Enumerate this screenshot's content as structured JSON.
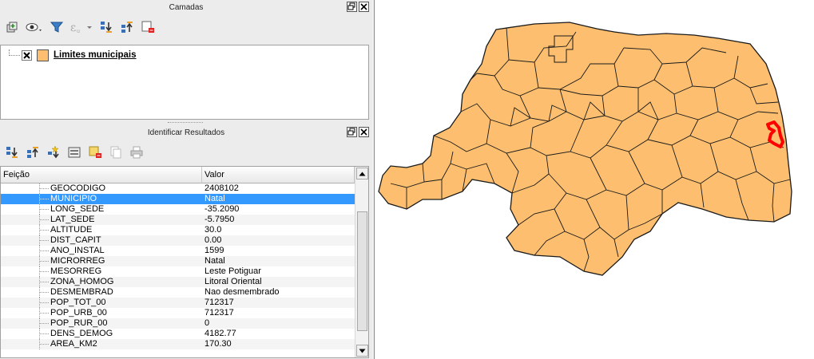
{
  "layers_dock": {
    "title": "Camadas",
    "layer": {
      "name": "Limites municipais",
      "checked": true,
      "swatch_color": "#fdbf6f"
    }
  },
  "identify_dock": {
    "title": "Identificar Resultados",
    "columns": {
      "feature": "Feição",
      "value": "Valor"
    },
    "rows": [
      {
        "field": "GEOCODIGO",
        "value": "2408102"
      },
      {
        "field": "MUNICIPIO",
        "value": "Natal",
        "selected": true
      },
      {
        "field": "LONG_SEDE",
        "value": "-35.2090"
      },
      {
        "field": "LAT_SEDE",
        "value": "-5.7950"
      },
      {
        "field": "ALTITUDE",
        "value": "30.0"
      },
      {
        "field": "DIST_CAPIT",
        "value": "0.00"
      },
      {
        "field": "ANO_INSTAL",
        "value": "1599"
      },
      {
        "field": "MICRORREG",
        "value": "Natal"
      },
      {
        "field": "MESORREG",
        "value": "Leste Potiguar"
      },
      {
        "field": "ZONA_HOMOG",
        "value": "Litoral Oriental"
      },
      {
        "field": "DESMEMBRAD",
        "value": "Nao desmembrado"
      },
      {
        "field": "POP_TOT_00",
        "value": "712317"
      },
      {
        "field": "POP_URB_00",
        "value": "712317"
      },
      {
        "field": "POP_RUR_00",
        "value": "0"
      },
      {
        "field": "DENS_DEMOG",
        "value": "4182.77"
      },
      {
        "field": "AREA_KM2",
        "value": "170.30"
      }
    ]
  },
  "colors": {
    "map_fill": "#fdbf6f",
    "map_outline": "#1a1a1a",
    "highlight": "#ff0000",
    "selection": "#3399ff"
  },
  "icons": {
    "layers_toolbar": [
      "add-group-icon",
      "eye-icon",
      "filter-icon",
      "expression-filter-icon",
      "expand-all-icon",
      "collapse-all-icon",
      "remove-layer-icon"
    ],
    "identify_toolbar": [
      "expand-tree-icon",
      "collapse-tree-icon",
      "expand-new-icon",
      "open-form-icon",
      "clear-results-icon",
      "copy-icon",
      "print-icon"
    ]
  }
}
